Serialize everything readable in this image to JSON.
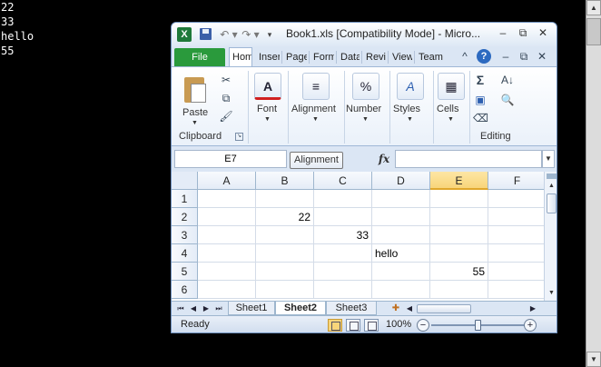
{
  "console": {
    "lines": [
      "22",
      "33",
      "hello",
      "55"
    ]
  },
  "window": {
    "title": "Book1.xls  [Compatibility Mode] - Micro...",
    "app_icon": "X",
    "controls": {
      "minimize": "–",
      "restore": "⧉",
      "close": "✕"
    }
  },
  "quick_access": {
    "save": "",
    "undo": "↶ ▾",
    "redo": "↷ ▾",
    "customize": "▾"
  },
  "ribbon_tabs": {
    "file": "File",
    "tabs": [
      "Home",
      "Insert",
      "Page Layout",
      "Formulas",
      "Data",
      "Review",
      "View",
      "Team"
    ],
    "active": "Home"
  },
  "ribbon": {
    "paste_label": "Paste",
    "clipboard_label": "Clipboard",
    "font_label": "Font",
    "alignment_label": "Alignment",
    "number_label": "Number",
    "styles_label": "Styles",
    "cells_label": "Cells",
    "editing_label": "Editing",
    "font_glyph": "A",
    "alignment_glyph": "≡",
    "number_glyph": "%",
    "styles_glyph": "A",
    "cells_glyph": "▦",
    "sum_glyph": "Σ",
    "sort_glyph": "A↓",
    "find_glyph": "🔍"
  },
  "formula_bar": {
    "name_box": "E7",
    "tooltip": "Alignment",
    "fx": "fx",
    "formula": ""
  },
  "grid": {
    "columns": [
      "A",
      "B",
      "C",
      "D",
      "E",
      "F"
    ],
    "selected_column": "E",
    "rows": [
      "1",
      "2",
      "3",
      "4",
      "5",
      "6"
    ],
    "cells": [
      {
        "ref": "B2",
        "value": "22",
        "type": "num"
      },
      {
        "ref": "C3",
        "value": "33",
        "type": "num"
      },
      {
        "ref": "D4",
        "value": "hello",
        "type": "text"
      },
      {
        "ref": "E5",
        "value": "55",
        "type": "num"
      }
    ]
  },
  "sheets": {
    "tabs": [
      "Sheet1",
      "Sheet2",
      "Sheet3"
    ],
    "active": "Sheet2"
  },
  "status": {
    "text": "Ready",
    "zoom": "100%",
    "zoom_level": 1.0
  },
  "colors": {
    "file_tab": "#2a9a3c",
    "selected_header": "#f8d57a",
    "window_frame": "#c9d9ee"
  }
}
